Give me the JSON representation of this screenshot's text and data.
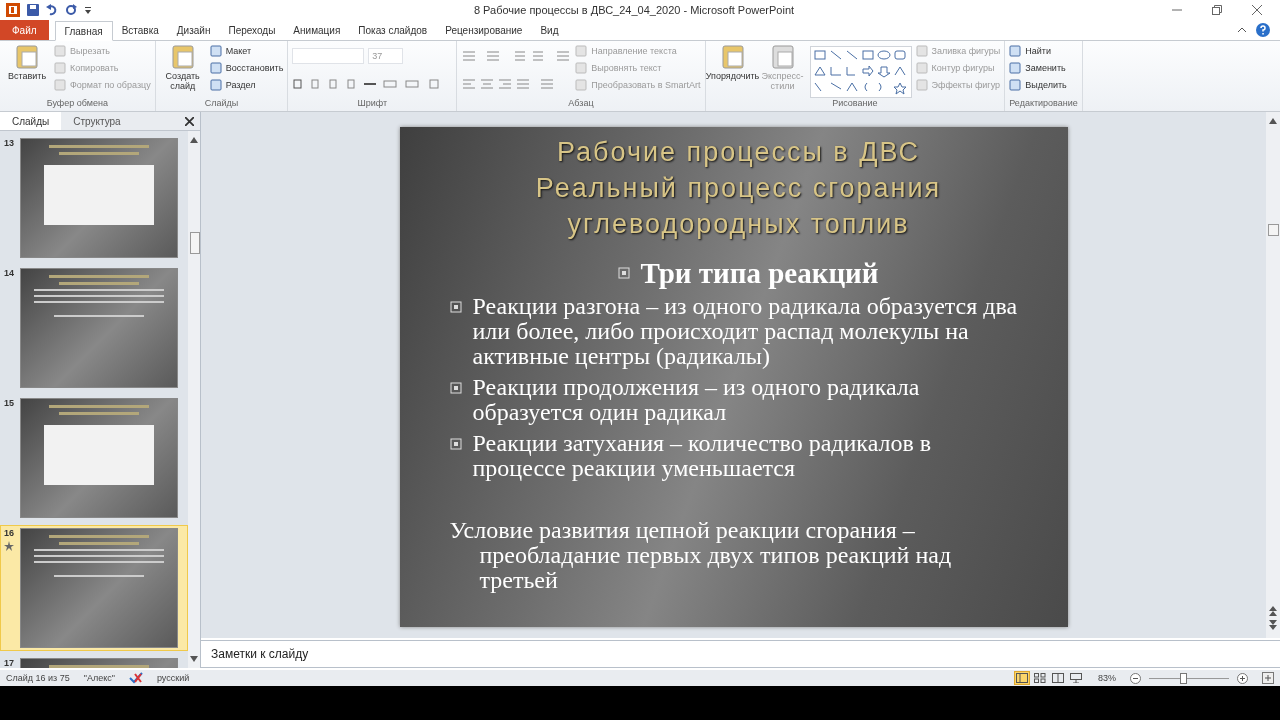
{
  "window": {
    "title": "8 Рабочие процессы в ДВС_24_04_2020  -  Microsoft PowerPoint"
  },
  "ribbon": {
    "tabs": [
      {
        "label": "Файл",
        "kind": "file",
        "selected": false
      },
      {
        "label": "Главная",
        "kind": "tab",
        "selected": true
      },
      {
        "label": "Вставка",
        "kind": "tab",
        "selected": false
      },
      {
        "label": "Дизайн",
        "kind": "tab",
        "selected": false
      },
      {
        "label": "Переходы",
        "kind": "tab",
        "selected": false
      },
      {
        "label": "Анимация",
        "kind": "tab",
        "selected": false
      },
      {
        "label": "Показ слайдов",
        "kind": "tab",
        "selected": false
      },
      {
        "label": "Рецензирование",
        "kind": "tab",
        "selected": false
      },
      {
        "label": "Вид",
        "kind": "tab",
        "selected": false
      }
    ],
    "groups": [
      {
        "title": "Буфер обмена",
        "kind": "standard",
        "large": [
          {
            "label": "Вставить",
            "disabled": false
          }
        ],
        "items": [
          {
            "label": "Вырезать",
            "disabled": true
          },
          {
            "label": "Копировать",
            "disabled": true
          },
          {
            "label": "Формат по образцу",
            "disabled": true
          }
        ]
      },
      {
        "title": "Слайды",
        "kind": "standard",
        "large": [
          {
            "label": "Создать слайд",
            "disabled": false
          }
        ],
        "items": [
          {
            "label": "Макет",
            "disabled": false
          },
          {
            "label": "Восстановить",
            "disabled": false
          },
          {
            "label": "Раздел",
            "disabled": false
          }
        ]
      },
      {
        "title": "Шрифт",
        "kind": "font",
        "font_size": "37"
      },
      {
        "title": "Абзац",
        "kind": "paragraph",
        "items": [
          {
            "label": "Направление текста",
            "disabled": true
          },
          {
            "label": "Выровнять текст",
            "disabled": true
          },
          {
            "label": "Преобразовать в SmartArt",
            "disabled": true
          }
        ]
      },
      {
        "title": "Рисование",
        "kind": "drawing",
        "large": [
          {
            "label": "Упорядочить",
            "disabled": false
          },
          {
            "label": "Экспресс-стили",
            "disabled": true
          }
        ],
        "items": [
          {
            "label": "Заливка фигуры",
            "disabled": true
          },
          {
            "label": "Контур фигуры",
            "disabled": true
          },
          {
            "label": "Эффекты фигур",
            "disabled": true
          }
        ]
      },
      {
        "title": "Редактирование",
        "kind": "standard",
        "items": [
          {
            "label": "Найти",
            "disabled": false
          },
          {
            "label": "Заменить",
            "disabled": false
          },
          {
            "label": "Выделить",
            "disabled": false
          }
        ]
      }
    ]
  },
  "side_panel": {
    "tabs": [
      {
        "label": "Слайды",
        "selected": true
      },
      {
        "label": "Структура",
        "selected": false
      }
    ],
    "slides": [
      {
        "number": "13",
        "kind": "picture",
        "selected": false,
        "animated": false
      },
      {
        "number": "14",
        "kind": "text",
        "selected": false,
        "animated": false
      },
      {
        "number": "15",
        "kind": "picture",
        "selected": false,
        "animated": false
      },
      {
        "number": "16",
        "kind": "text",
        "selected": true,
        "animated": true
      },
      {
        "number": "17",
        "kind": "text",
        "selected": false,
        "animated": false
      }
    ]
  },
  "slide": {
    "title_lines": [
      "Рабочие процессы в ДВС",
      "Реальный процесс сгорания",
      "углеводородных топлив"
    ],
    "heading": "Три типа реакций",
    "bullets": [
      "Реакции разгона – из одного радикала образуется два или более, либо происходит распад молекулы на активные центры (радикалы)",
      "Реакции продолжения – из одного радикала образуется  один радикал",
      "Реакции затухания – количество радикалов в процессе реакции уменьшается"
    ],
    "conclusion": "Условие развития цепной реакции сгорания – преобладание первых двух типов реакций над третьей"
  },
  "notes": {
    "placeholder": "Заметки к слайду"
  },
  "status_bar": {
    "slide_info": "Слайд 16 из 75",
    "theme": "\"Алекс\"",
    "language": "русский",
    "views": [
      {
        "kind": "normal",
        "selected": true
      },
      {
        "kind": "sorter",
        "selected": false
      },
      {
        "kind": "reading",
        "selected": false
      },
      {
        "kind": "slideshow",
        "selected": false
      }
    ],
    "zoom": "83%",
    "zoom_slider": {
      "level": 0.43
    }
  }
}
